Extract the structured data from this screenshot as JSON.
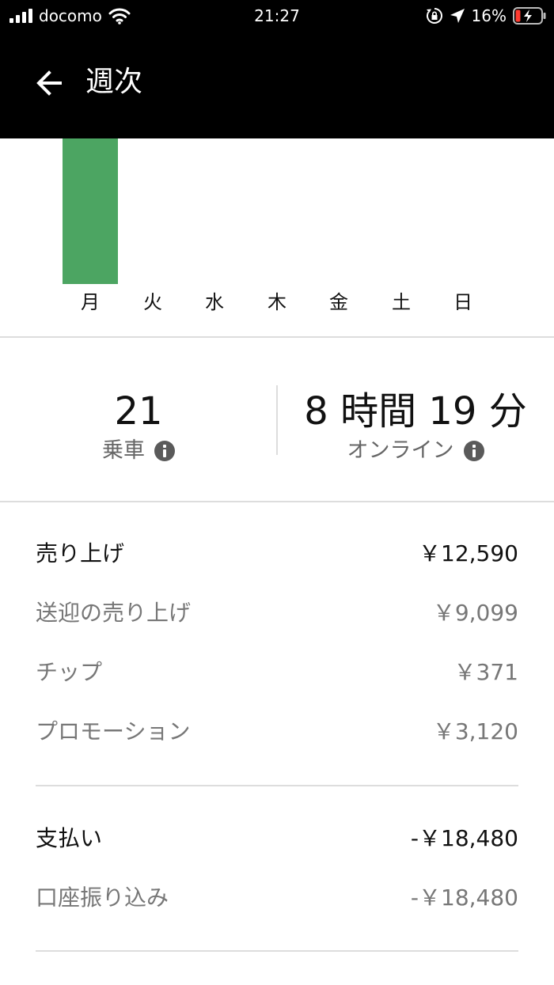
{
  "status_bar": {
    "carrier": "docomo",
    "time": "21:27",
    "battery": "16%",
    "icons": [
      "signal-icon",
      "wifi-icon",
      "orientation-lock-icon",
      "location-arrow-icon",
      "battery-charging-icon"
    ]
  },
  "header": {
    "back_icon": "arrow-left-icon",
    "title": "週次"
  },
  "chart_data": {
    "type": "bar",
    "categories": [
      "月",
      "火",
      "水",
      "木",
      "金",
      "土",
      "日"
    ],
    "values": [
      12590,
      0,
      0,
      0,
      0,
      0,
      0
    ],
    "bar_color": "#4CA562",
    "ylim": [
      0,
      12590
    ],
    "grid": false
  },
  "stats": {
    "rides": {
      "value": "21",
      "label": "乗車"
    },
    "online": {
      "value": "8 時間 19 分",
      "label": "オンライン"
    }
  },
  "earnings": {
    "total": {
      "label": "売り上げ",
      "value": "￥12,590"
    },
    "fares": {
      "label": "送迎の売り上げ",
      "value": "￥9,099"
    },
    "tips": {
      "label": "チップ",
      "value": "￥371"
    },
    "promotions": {
      "label": "プロモーション",
      "value": "￥3,120"
    }
  },
  "payouts": {
    "total": {
      "label": "支払い",
      "value": "-￥18,480"
    },
    "bank_transfer": {
      "label": "口座振り込み",
      "value": "-￥18,480"
    }
  },
  "colors": {
    "header_bg": "#000000",
    "bar": "#4CA562",
    "divider": "#dddddd",
    "secondary_text": "#777777"
  }
}
